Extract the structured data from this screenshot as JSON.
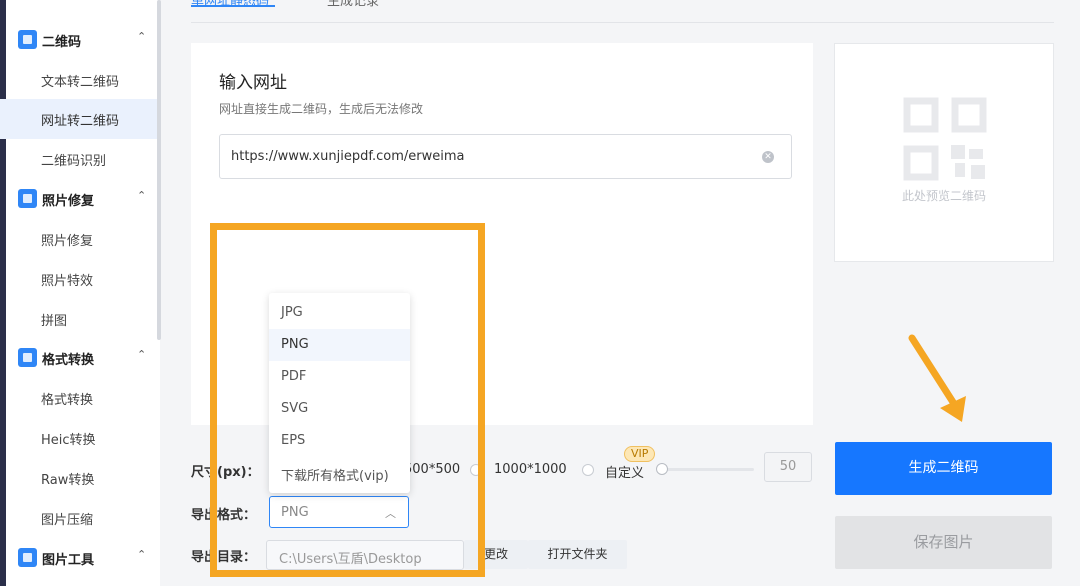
{
  "sidebar": {
    "groups": [
      {
        "label": "二维码",
        "icon": "qr-group-icon",
        "items": [
          "文本转二维码",
          "网址转二维码",
          "二维码识别"
        ]
      },
      {
        "label": "照片修复",
        "icon": "photo-group-icon",
        "items": [
          "照片修复",
          "照片特效",
          "拼图"
        ]
      },
      {
        "label": "格式转换",
        "icon": "convert-group-icon",
        "items": [
          "格式转换",
          "Heic转换",
          "Raw转换",
          "图片压缩"
        ]
      },
      {
        "label": "图片工具",
        "icon": "image-tools-group-icon",
        "items": []
      }
    ],
    "active_item": "网址转二维码"
  },
  "tabs": [
    "单网址静态码",
    "生成记录"
  ],
  "card": {
    "title": "输入网址",
    "subtitle": "网址直接生成二维码，生成后无法修改",
    "url_value": "https://www.xunjiepdf.com/erweima"
  },
  "preview": {
    "caption": "此处预览二维码"
  },
  "settings": {
    "size_label": "尺寸(px)：",
    "size_options": [
      "500*500",
      "1000*1000",
      "自定义"
    ],
    "vip_badge": "VIP",
    "custom_size_value": "50",
    "format_label": "导出格式：",
    "format_value": "PNG",
    "dir_label": "导出目录：",
    "dir_value": "C:\\Users\\互盾\\Desktop",
    "change_button": "更改",
    "open_folder_button": "打开文件夹"
  },
  "dropdown": {
    "options": [
      "JPG",
      "PNG",
      "PDF",
      "SVG",
      "EPS",
      "下载所有格式(vip)"
    ],
    "selected": "PNG"
  },
  "buttons": {
    "generate": "生成二维码",
    "save": "保存图片"
  },
  "colors": {
    "accent": "#1677ff",
    "annotation": "#f5a623"
  }
}
